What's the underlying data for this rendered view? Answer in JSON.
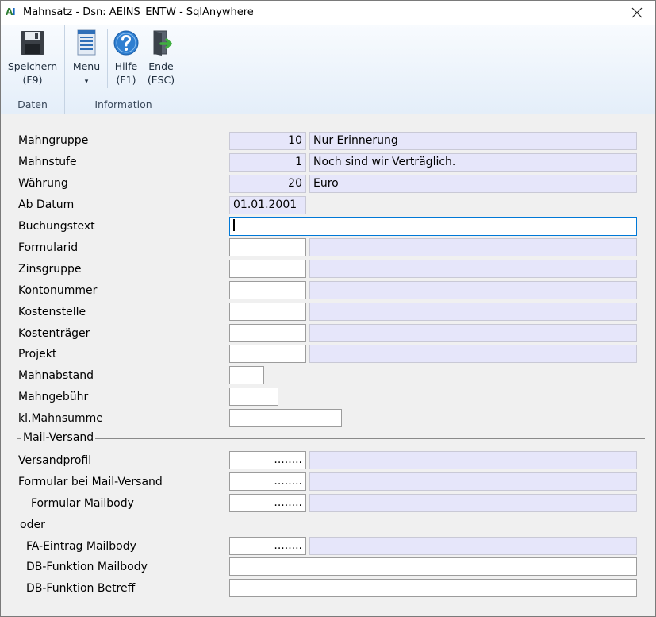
{
  "window": {
    "title": "Mahnsatz - Dsn: AEINS_ENTW - SqlAnywhere",
    "logo": {
      "a": "A",
      "i": "I"
    }
  },
  "ribbon": {
    "groups": [
      {
        "label": "Daten"
      },
      {
        "label": "Information"
      }
    ],
    "buttons": {
      "save": {
        "label": "Speichern",
        "shortcut": "(F9)"
      },
      "menu": {
        "label": "Menu",
        "arrow": "▾"
      },
      "help": {
        "label": "Hilfe",
        "shortcut": "(F1)"
      },
      "exit": {
        "label": "Ende",
        "shortcut": "(ESC)"
      }
    }
  },
  "form": {
    "mahngruppe": {
      "label": "Mahngruppe",
      "code": "10",
      "text": "Nur Erinnerung"
    },
    "mahnstufe": {
      "label": "Mahnstufe",
      "code": "1",
      "text": "Noch sind wir Verträglich."
    },
    "waehrung": {
      "label": "Währung",
      "code": "20",
      "text": "Euro"
    },
    "ab_datum": {
      "label": "Ab Datum",
      "value": "01.01.2001"
    },
    "buchungstext": {
      "label": "Buchungstext",
      "value": ""
    },
    "formularid": {
      "label": "Formularid",
      "value": "",
      "text": ""
    },
    "zinsgruppe": {
      "label": "Zinsgruppe",
      "value": "",
      "text": ""
    },
    "kontonummer": {
      "label": "Kontonummer",
      "value": "",
      "text": ""
    },
    "kostenstelle": {
      "label": "Kostenstelle",
      "value": "",
      "text": ""
    },
    "kostentraeger": {
      "label": "Kostenträger",
      "value": "",
      "text": ""
    },
    "projekt": {
      "label": "Projekt",
      "value": "",
      "text": ""
    },
    "mahnabstand": {
      "label": "Mahnabstand",
      "value": ""
    },
    "mahngebuehr": {
      "label": "Mahngebühr",
      "value": ""
    },
    "kl_mahnsumme": {
      "label": "kl.Mahnsumme",
      "value": ""
    }
  },
  "mail": {
    "section_title": "Mail-Versand",
    "versandprofil": {
      "label": "Versandprofil",
      "value": "........",
      "text": ""
    },
    "formular_mail": {
      "label": "Formular bei Mail-Versand",
      "value": "........",
      "text": ""
    },
    "formular_mailbody": {
      "label": "Formular Mailbody",
      "value": "........",
      "text": ""
    },
    "oder": "oder",
    "fa_eintrag": {
      "label": "FA-Eintrag Mailbody",
      "value": "........",
      "text": ""
    },
    "db_funktion_mailbody": {
      "label": "DB-Funktion Mailbody",
      "value": ""
    },
    "db_funktion_betreff": {
      "label": "DB-Funktion Betreff",
      "value": ""
    }
  },
  "colors": {
    "readonly_field": "#e6e6fa",
    "focus_border": "#0078d7",
    "ribbon_top": "#f8fbfe",
    "ribbon_bottom": "#e4eef9"
  }
}
